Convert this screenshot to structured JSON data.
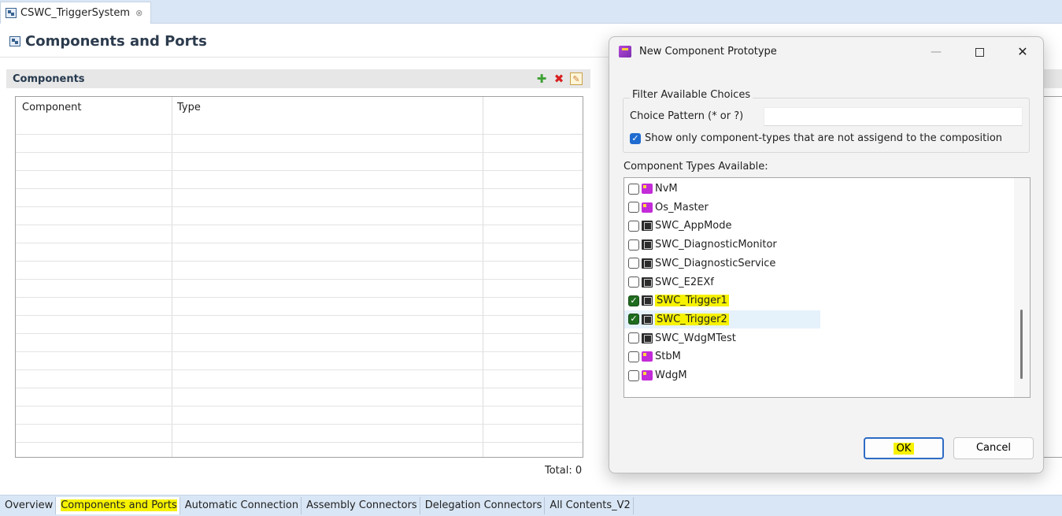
{
  "editor": {
    "tab_title": "CSWC_TriggerSystem",
    "tab_close_glyph": "⊗",
    "page_title": "Components and Ports"
  },
  "components_section": {
    "title": "Components",
    "toolbar": {
      "add_icon": "add-icon",
      "delete_icon": "delete-icon",
      "edit_icon": "edit-icon"
    },
    "columns": [
      "Component",
      "Type",
      ""
    ],
    "rows": [],
    "total_label": "Total: 0"
  },
  "bottom_tabs": [
    {
      "label": "Overview"
    },
    {
      "label": "Components and Ports",
      "active": true
    },
    {
      "label": "Automatic Connection"
    },
    {
      "label": "Assembly Connectors"
    },
    {
      "label": "Delegation Connectors"
    },
    {
      "label": "All Contents_V2"
    }
  ],
  "dialog": {
    "title": "New Component Prototype",
    "filter_group_label": "Filter Available Choices",
    "choice_pattern_label": "Choice Pattern (* or ?)",
    "choice_pattern_value": "",
    "show_only_label": "Show only component-types that are not assigend to the composition",
    "show_only_checked": true,
    "types_label": "Component Types Available:",
    "types": [
      {
        "label": "NvM",
        "icon": "bsw-module-icon",
        "checked": false
      },
      {
        "label": "Os_Master",
        "icon": "bsw-module-icon",
        "checked": false
      },
      {
        "label": "SWC_AppMode",
        "icon": "swc-icon",
        "checked": false
      },
      {
        "label": "SWC_DiagnosticMonitor",
        "icon": "swc-icon",
        "checked": false
      },
      {
        "label": "SWC_DiagnosticService",
        "icon": "swc-icon",
        "checked": false
      },
      {
        "label": "SWC_E2EXf",
        "icon": "swc-icon",
        "checked": false
      },
      {
        "label": "SWC_Trigger1",
        "icon": "swc-icon",
        "checked": true
      },
      {
        "label": "SWC_Trigger2",
        "icon": "swc-icon",
        "checked": true
      },
      {
        "label": "SWC_WdgMTest",
        "icon": "swc-icon",
        "checked": false
      },
      {
        "label": "StbM",
        "icon": "bsw-module-icon",
        "checked": false
      },
      {
        "label": "WdgM",
        "icon": "bsw-module-icon",
        "checked": false
      }
    ],
    "ok_label": "OK",
    "cancel_label": "Cancel"
  },
  "colors": {
    "highlight": "#f6f200",
    "accent": "#2d6bc5",
    "check_green": "#1f6b1f"
  }
}
